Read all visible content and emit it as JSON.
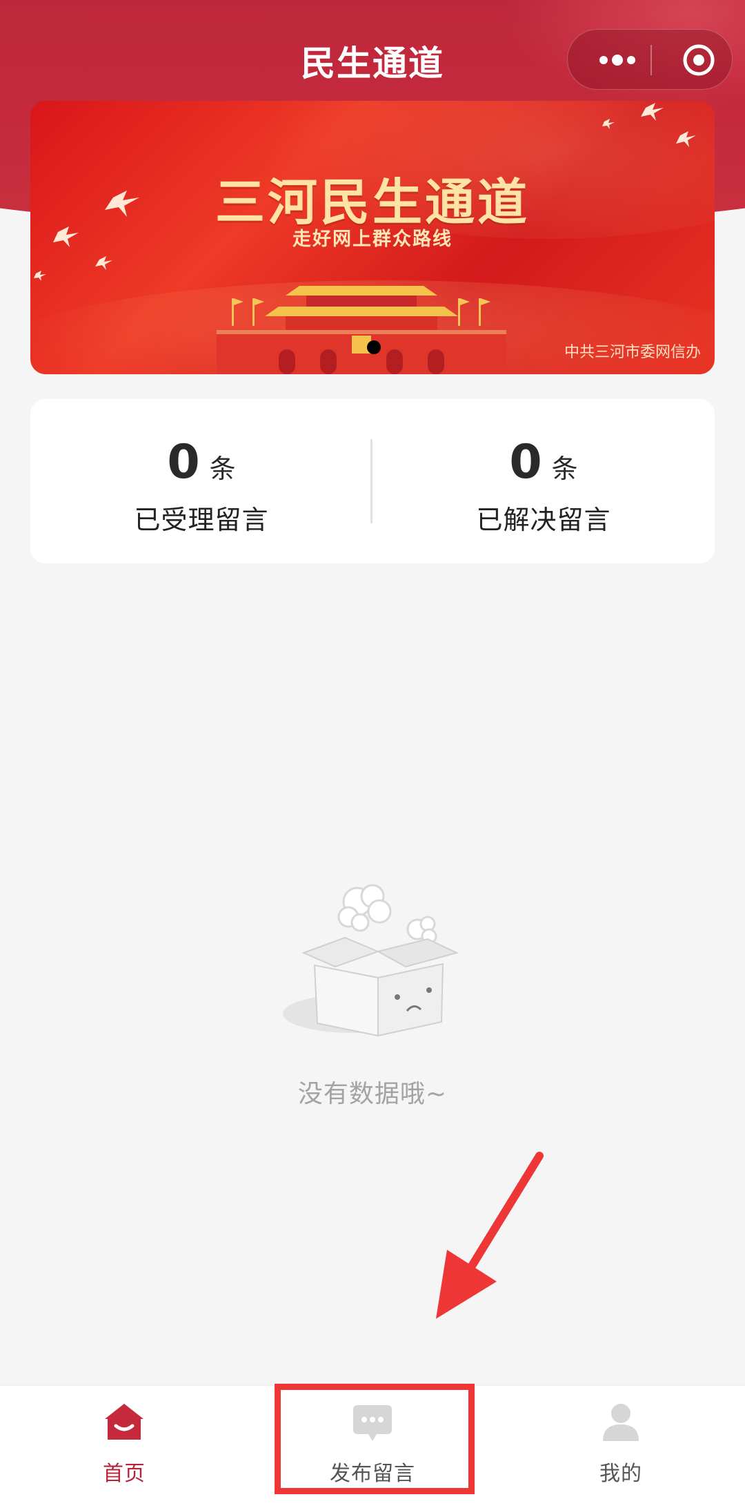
{
  "app": {
    "title": "民生通道"
  },
  "capsule": {
    "more_icon": "more-dots-icon",
    "close_icon": "target-circle-icon"
  },
  "banner": {
    "title": "三河民生通道",
    "subtitle": "走好网上群众路线",
    "org": "中共三河市委网信办",
    "slide_count": 1,
    "active_slide": 1
  },
  "stats": [
    {
      "count": "0",
      "unit": "条",
      "label": "已受理留言"
    },
    {
      "count": "0",
      "unit": "条",
      "label": "已解决留言"
    }
  ],
  "empty": {
    "text": "没有数据哦~",
    "icon": "empty-box-icon"
  },
  "tabbar": {
    "items": [
      {
        "label": "首页",
        "icon": "home-icon",
        "active": true
      },
      {
        "label": "发布留言",
        "icon": "message-icon",
        "active": false
      },
      {
        "label": "我的",
        "icon": "user-icon",
        "active": false
      }
    ]
  },
  "colors": {
    "brand_red": "#b8233a",
    "banner_red": "#e0261f",
    "gold_text": "#ffe3a6",
    "page_bg": "#f5f5f5",
    "annotation_red": "#ee3636",
    "muted_text": "#a3a3a3"
  },
  "annotation": {
    "target": "发布留言"
  }
}
